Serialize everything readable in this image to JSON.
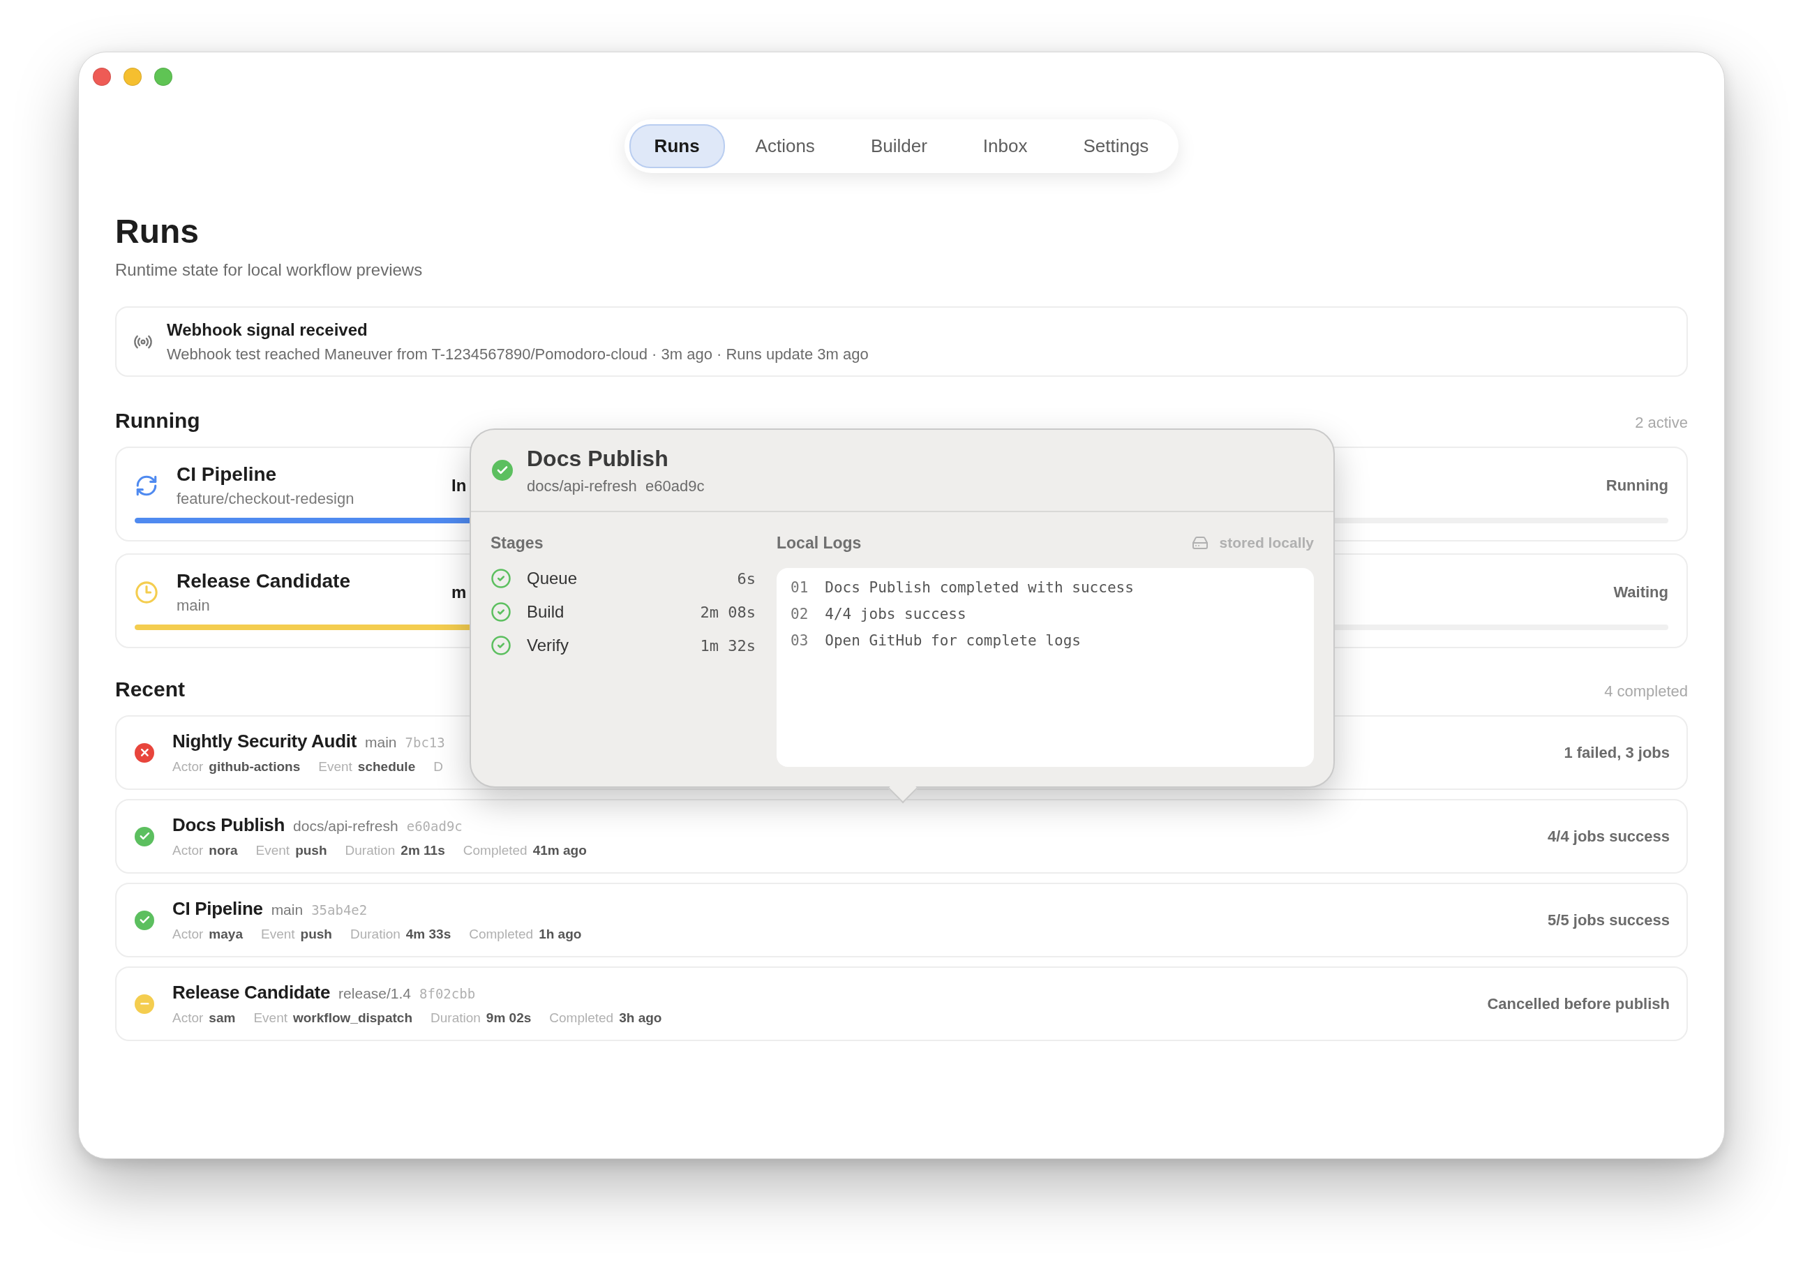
{
  "tabs": [
    {
      "label": "Runs",
      "selected": true
    },
    {
      "label": "Actions",
      "selected": false
    },
    {
      "label": "Builder",
      "selected": false
    },
    {
      "label": "Inbox",
      "selected": false
    },
    {
      "label": "Settings",
      "selected": false
    }
  ],
  "page": {
    "title": "Runs",
    "subtitle": "Runtime state for local workflow previews"
  },
  "notice": {
    "title": "Webhook signal received",
    "message": "Webhook test reached Maneuver from T-1234567890/Pomodoro-cloud · 3m ago · Runs update 3m ago"
  },
  "running": {
    "title": "Running",
    "count": "2 active",
    "items": [
      {
        "name": "CI Pipeline",
        "branch": "feature/checkout-redesign",
        "detail": "In",
        "status": "Running",
        "kind": "running",
        "level": 0.42
      },
      {
        "name": "Release Candidate",
        "branch": "main",
        "detail": "m",
        "status": "Waiting",
        "kind": "waiting",
        "level": 0.38
      }
    ]
  },
  "recent": {
    "title": "Recent",
    "count": "4 completed",
    "items": [
      {
        "name": "Nightly Security Audit",
        "branch": "main",
        "commit": "7bc13",
        "kind": "failed",
        "meta": [
          {
            "label": "Actor",
            "value": "github-actions"
          },
          {
            "label": "Event",
            "value": "schedule"
          },
          {
            "label": "D"
          }
        ],
        "summary": "1 failed, 3 jobs"
      },
      {
        "name": "Docs Publish",
        "branch": "docs/api-refresh",
        "commit": "e60ad9c",
        "kind": "success",
        "meta": [
          {
            "label": "Actor",
            "value": "nora"
          },
          {
            "label": "Event",
            "value": "push"
          },
          {
            "label": "Duration",
            "value": "2m 11s"
          },
          {
            "label": "Completed",
            "value": "41m ago"
          }
        ],
        "summary": "4/4 jobs success"
      },
      {
        "name": "CI Pipeline",
        "branch": "main",
        "commit": "35ab4e2",
        "kind": "success",
        "meta": [
          {
            "label": "Actor",
            "value": "maya"
          },
          {
            "label": "Event",
            "value": "push"
          },
          {
            "label": "Duration",
            "value": "4m 33s"
          },
          {
            "label": "Completed",
            "value": "1h ago"
          }
        ],
        "summary": "5/5 jobs success"
      },
      {
        "name": "Release Candidate",
        "branch": "release/1.4",
        "commit": "8f02cbb",
        "kind": "cancelled",
        "meta": [
          {
            "label": "Actor",
            "value": "sam"
          },
          {
            "label": "Event",
            "value": "workflow_dispatch"
          },
          {
            "label": "Duration",
            "value": "9m 02s"
          },
          {
            "label": "Completed",
            "value": "3h ago"
          }
        ],
        "summary": "Cancelled before publish"
      }
    ]
  },
  "popover": {
    "kind": "success",
    "title": "Docs Publish",
    "branch": "docs/api-refresh",
    "commit": "e60ad9c",
    "stages_title": "Stages",
    "stages": [
      {
        "name": "Queue",
        "duration": "6s",
        "done": true
      },
      {
        "name": "Build",
        "duration": "2m 08s",
        "done": true
      },
      {
        "name": "Verify",
        "duration": "1m 32s",
        "done": true
      }
    ],
    "logs_title": "Local Logs",
    "storage": "stored locally",
    "logs": [
      {
        "number": "01",
        "text": "Docs Publish completed with success"
      },
      {
        "number": "02",
        "text": "4/4 jobs success"
      },
      {
        "number": "03",
        "text": "Open GitHub for complete logs"
      }
    ]
  }
}
